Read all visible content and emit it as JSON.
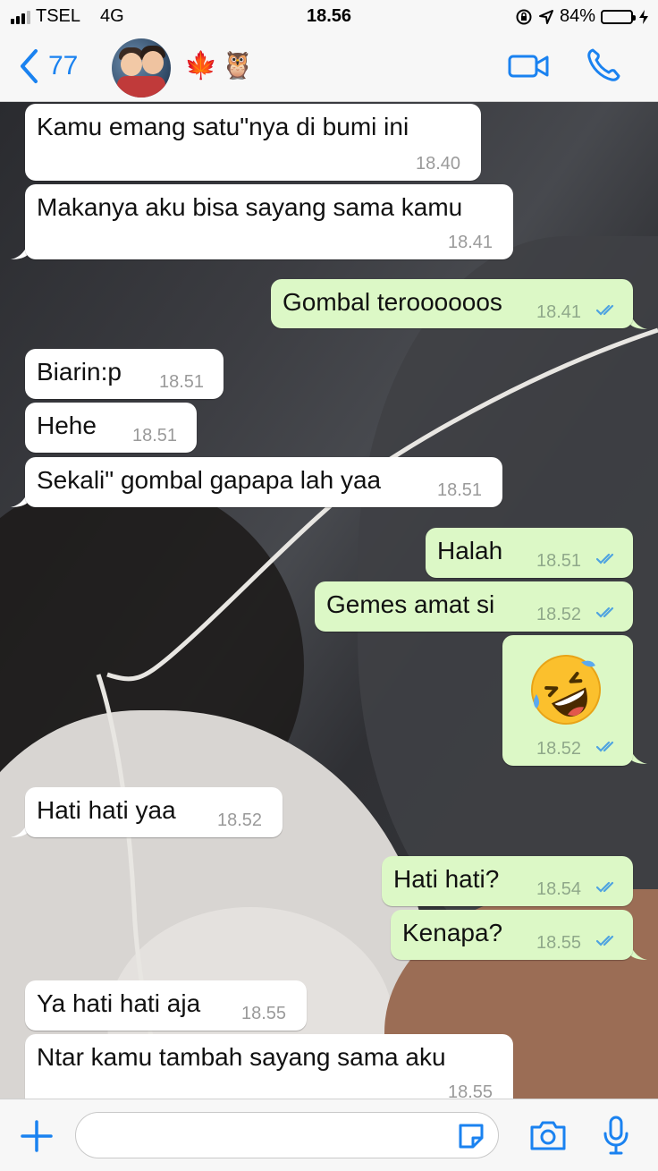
{
  "status_bar": {
    "carrier": "TSEL",
    "network": "4G",
    "time": "18.56",
    "battery_percent": "84%",
    "battery_level": 0.84
  },
  "header": {
    "back_count": "77",
    "contact_emoji": "🍁🦉",
    "icons": [
      "chevron-left-icon",
      "avatar",
      "video-call-icon",
      "phone-call-icon"
    ]
  },
  "messages": [
    {
      "dir": "in",
      "text": "Kamu emang satu\"nya di bumi ini",
      "time": "18.40"
    },
    {
      "dir": "in",
      "text": "Makanya aku bisa sayang sama kamu",
      "time": "18.41"
    },
    {
      "dir": "out",
      "text": "Gombal teroooooos",
      "time": "18.41"
    },
    {
      "dir": "in",
      "text": "Biarin:p",
      "time": "18.51"
    },
    {
      "dir": "in",
      "text": "Hehe",
      "time": "18.51"
    },
    {
      "dir": "in",
      "text": "Sekali\" gombal gapapa lah yaa",
      "time": "18.51"
    },
    {
      "dir": "out",
      "text": "Halah",
      "time": "18.51"
    },
    {
      "dir": "out",
      "text": "Gemes amat si",
      "time": "18.52"
    },
    {
      "dir": "out",
      "emoji": "rolling-on-floor-laughing-emoji",
      "time": "18.52"
    },
    {
      "dir": "in",
      "text": "Hati hati yaa",
      "time": "18.52"
    },
    {
      "dir": "out",
      "text": "Hati hati?",
      "time": "18.54"
    },
    {
      "dir": "out",
      "text": "Kenapa?",
      "time": "18.55"
    },
    {
      "dir": "in",
      "text": "Ya hati hati aja",
      "time": "18.55"
    },
    {
      "dir": "in",
      "text": "Ntar kamu tambah sayang sama aku",
      "time": "18.55"
    }
  ],
  "input_bar": {
    "message_value": "",
    "icons": [
      "plus-icon",
      "sticker-icon",
      "camera-icon",
      "microphone-icon"
    ]
  },
  "colors": {
    "accent": "#1a82f0",
    "incoming_bubble": "#ffffff",
    "outgoing_bubble": "#dcf8c6",
    "read_ticks": "#4fa3e0",
    "battery": "#4cd964"
  }
}
